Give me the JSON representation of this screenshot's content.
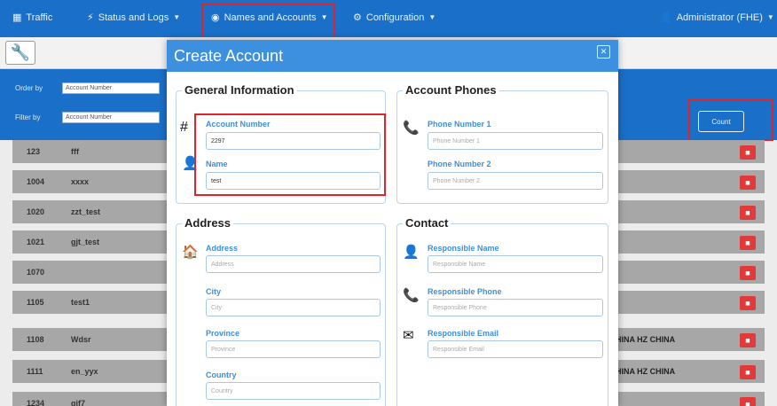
{
  "nav": {
    "traffic": "Traffic",
    "status": "Status and Logs",
    "names": "Names and Accounts",
    "config": "Configuration",
    "user": "Administrator (FHE)"
  },
  "filters": {
    "order_label": "Order by",
    "order_value": "Account Number",
    "filter_label": "Filter by",
    "filter_value": "Account Number",
    "count_label": "Count"
  },
  "rows": [
    {
      "num": "123",
      "name": "fff",
      "extra": ""
    },
    {
      "num": "1004",
      "name": "xxxx",
      "extra": ""
    },
    {
      "num": "1020",
      "name": "zzt_test",
      "extra": ""
    },
    {
      "num": "1021",
      "name": "gjt_test",
      "extra": ""
    },
    {
      "num": "1070",
      "name": "",
      "extra": ""
    },
    {
      "num": "1105",
      "name": "test1",
      "extra": ""
    },
    {
      "num": "1108",
      "name": "Wdsr",
      "extra": "HINA HZ CHINA"
    },
    {
      "num": "1111",
      "name": "en_yyx",
      "extra": "HINA HZ CHINA"
    },
    {
      "num": "1234",
      "name": "gjf7",
      "extra": ""
    }
  ],
  "modal": {
    "title": "Create Account",
    "general": {
      "legend": "General Information",
      "account_number_label": "Account Number",
      "account_number_value": "2297",
      "name_label": "Name",
      "name_value": "test"
    },
    "phones": {
      "legend": "Account Phones",
      "phone1_label": "Phone Number 1",
      "phone1_placeholder": "Phone Number 1",
      "phone2_label": "Phone Number 2",
      "phone2_placeholder": "Phone Number 2"
    },
    "address": {
      "legend": "Address",
      "address_label": "Address",
      "address_placeholder": "Address",
      "city_label": "City",
      "city_placeholder": "City",
      "province_label": "Province",
      "province_placeholder": "Province",
      "country_label": "Country",
      "country_placeholder": "Country"
    },
    "contact": {
      "legend": "Contact",
      "resp_name_label": "Responsible Name",
      "resp_name_placeholder": "Responsible Name",
      "resp_phone_label": "Responsible Phone",
      "resp_phone_placeholder": "Responsible Phone",
      "resp_email_label": "Responsible Email",
      "resp_email_placeholder": "Responsible Email"
    }
  },
  "colors": {
    "primary": "#1a6fc9",
    "modal_header": "#3d8fe0",
    "highlight": "#e0242c",
    "delete": "#e23a3a"
  }
}
